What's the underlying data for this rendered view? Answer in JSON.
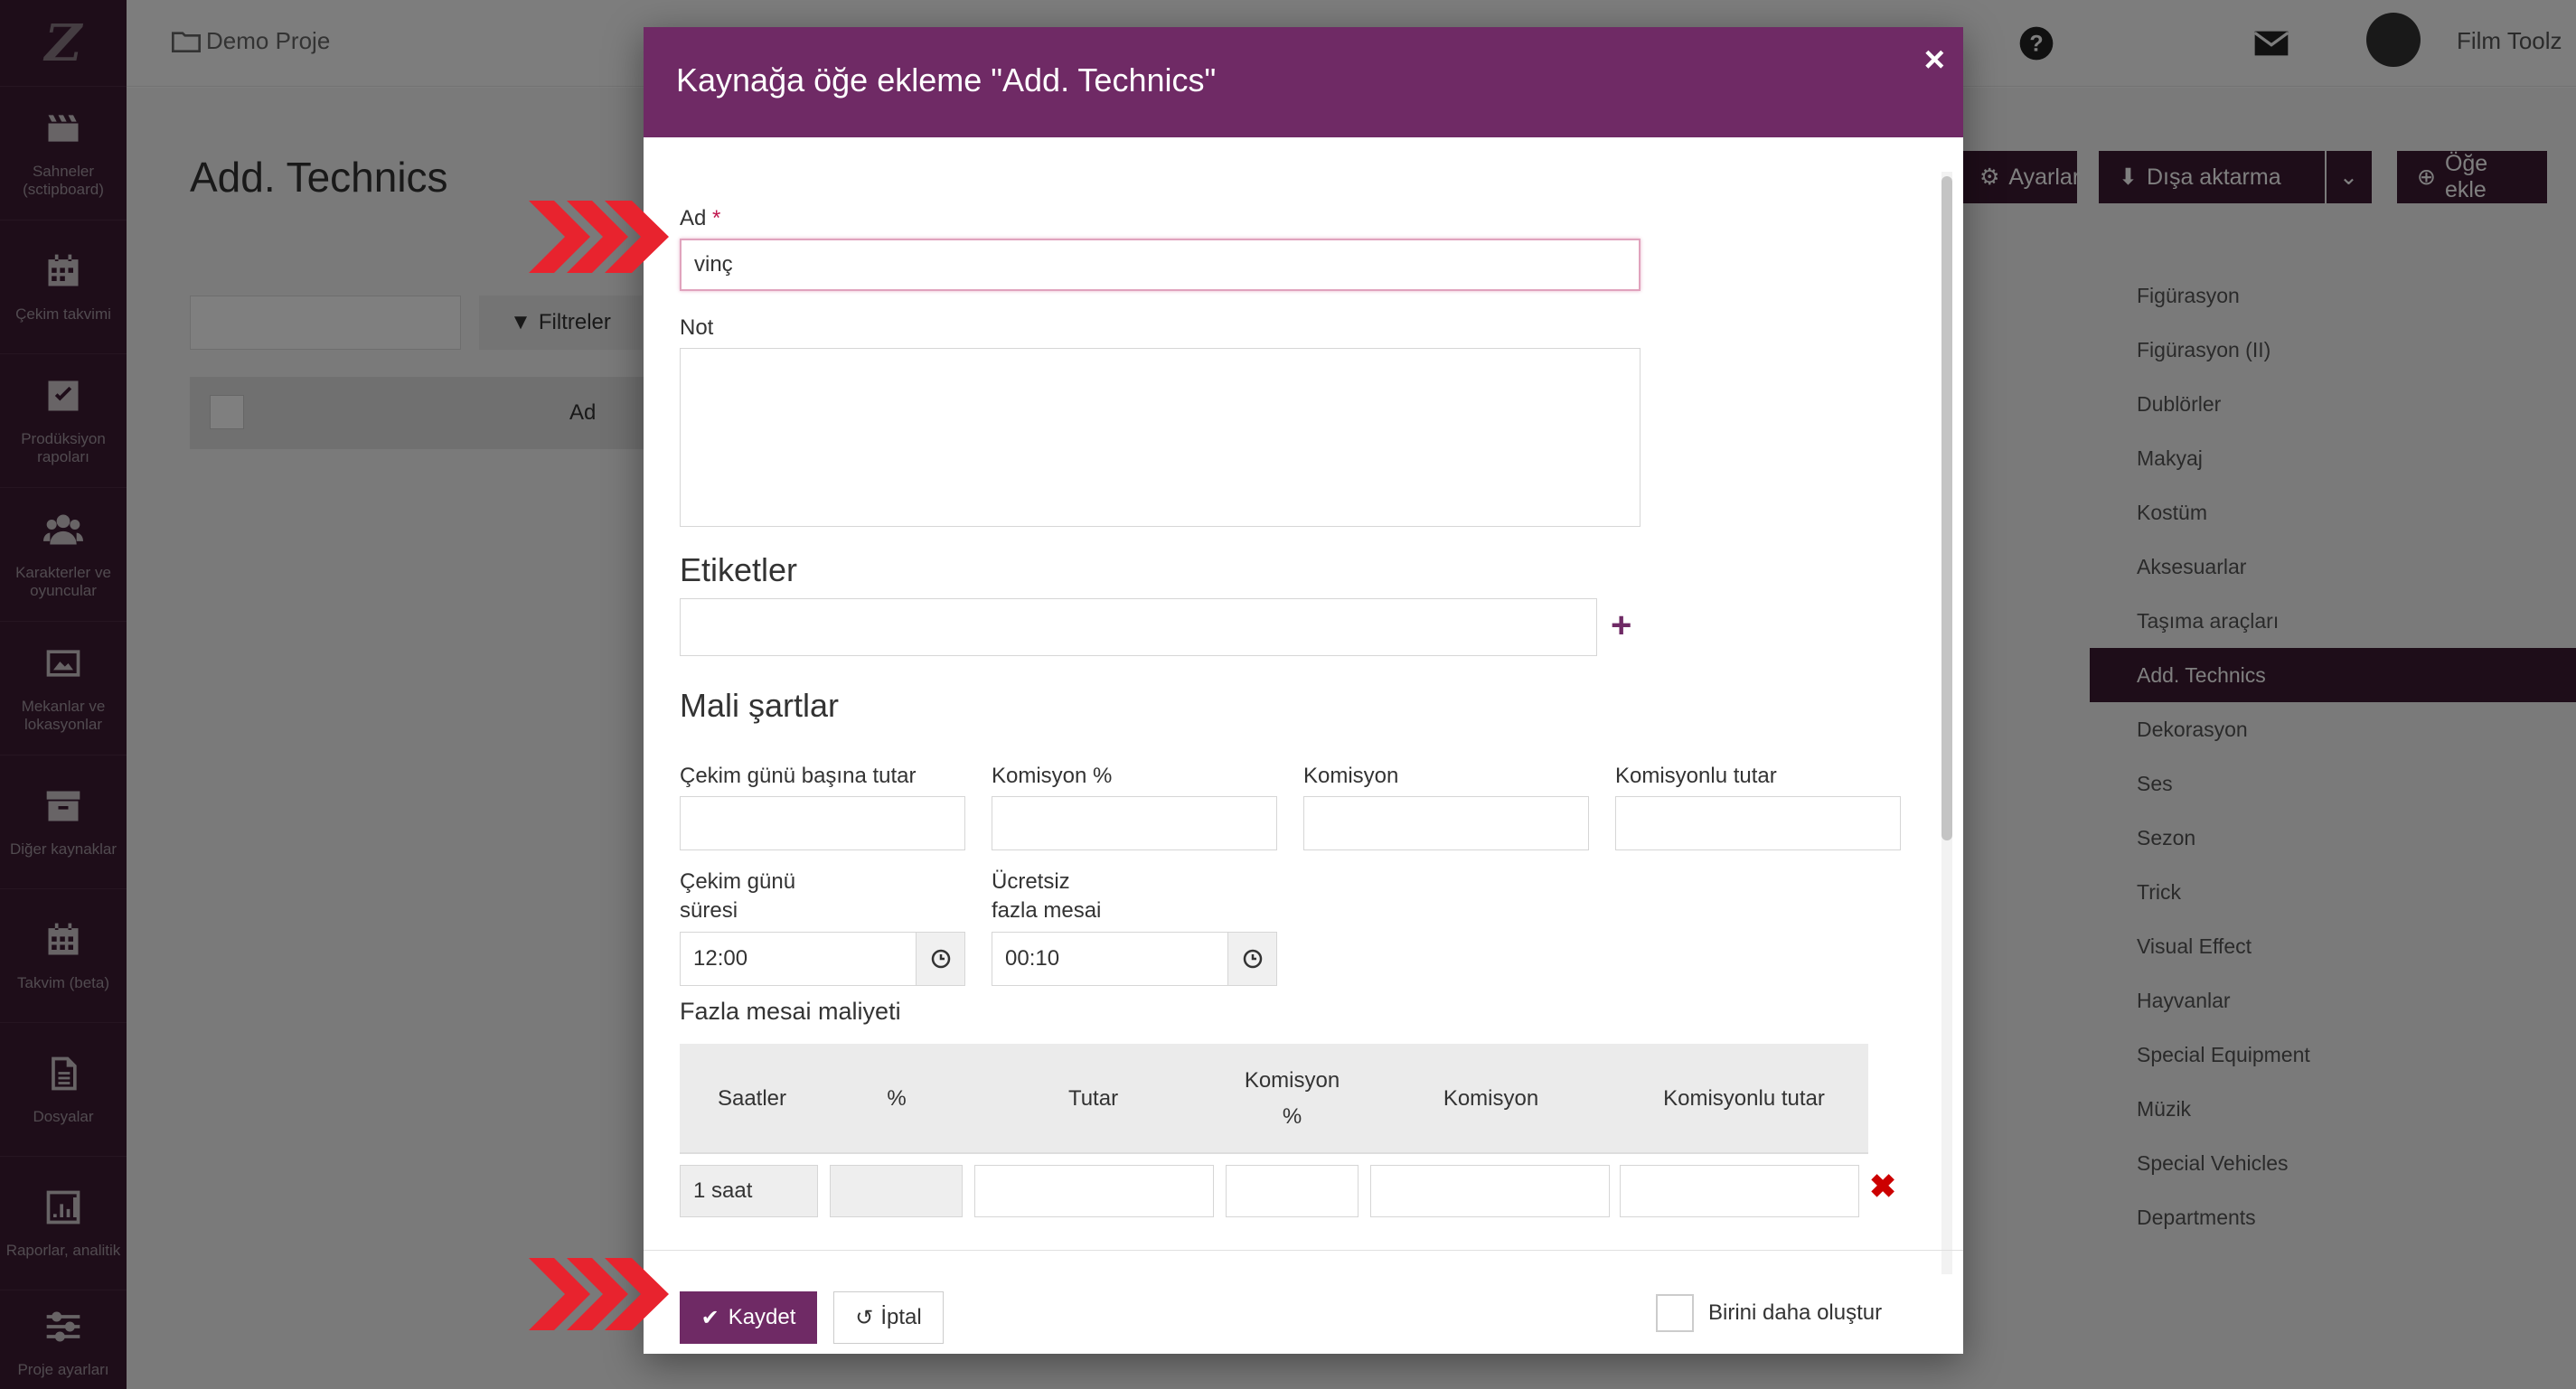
{
  "sidebar": {
    "items": [
      {
        "label": "Sahneler (sctipboard)",
        "icon": "clapperboard-icon"
      },
      {
        "label": "Çekim takvimi",
        "icon": "calendar-icon"
      },
      {
        "label": "Prodüksiyon rapoları",
        "icon": "checkbox-icon"
      },
      {
        "label": "Karakterler ve oyuncular",
        "icon": "users-icon"
      },
      {
        "label": "Mekanlar ve lokasyonlar",
        "icon": "image-icon"
      },
      {
        "label": "Diğer kaynaklar",
        "icon": "archive-icon"
      },
      {
        "label": "Takvim (beta)",
        "icon": "calendar-grid-icon"
      },
      {
        "label": "Dosyalar",
        "icon": "file-icon"
      },
      {
        "label": "Raporlar, analitik",
        "icon": "bar-chart-icon"
      },
      {
        "label": "Proje ayarları",
        "icon": "sliders-icon"
      }
    ]
  },
  "topbar": {
    "project": "Demo Proje",
    "user": "Film Toolz",
    "lang": "TR"
  },
  "page": {
    "title": "Add. Technics",
    "btn_settings": "Ayarlar",
    "btn_export": "Dışa aktarma",
    "btn_add": "Öğe ekle",
    "filters": "Filtreler",
    "col_name": "Ad"
  },
  "resources": [
    "Figürasyon",
    "Figürasyon (II)",
    "Dublörler",
    "Makyaj",
    "Kostüm",
    "Aksesuarlar",
    "Taşıma araçları",
    "Add. Technics",
    "Dekorasyon",
    "Ses",
    "Sezon",
    "Trick",
    "Visual Effect",
    "Hayvanlar",
    "Special Equipment",
    "Müzik",
    "Special Vehicles",
    "Departments"
  ],
  "modal": {
    "title": "Kaynağa öğe ekleme \"Add. Technics\"",
    "close": "×",
    "name_label": "Ad",
    "required_mark": "*",
    "name_value": "vinç",
    "note_label": "Not",
    "tags_title": "Etiketler",
    "finance_title": "Mali şartlar",
    "daily_label": "Çekim günü başına tutar",
    "commission_pct_label": "Komisyon %",
    "commission_label": "Komisyon",
    "total_label": "Komisyonlu tutar",
    "duration_label_1": "Çekim günü",
    "duration_label_2": "süresi",
    "duration_value": "12:00",
    "free_ot_label_1": "Ücretsiz",
    "free_ot_label_2": "fazla mesai",
    "free_ot_value": "00:10",
    "ot_title": "Fazla mesai maliyeti",
    "ot_cols": {
      "hours": "Saatler",
      "pct": "%",
      "amount": "Tutar",
      "comm_pct_1": "Komisyon",
      "comm_pct_2": "%",
      "comm": "Komisyon",
      "total": "Komisyonlu tutar"
    },
    "ot_row_hours": "1 saat",
    "save": "Kaydet",
    "cancel": "İptal",
    "create_another": "Birini daha oluştur"
  },
  "colors": {
    "brand": "#6f2a65",
    "sidebar": "#3d1a33",
    "arrow": "#e8232e"
  }
}
